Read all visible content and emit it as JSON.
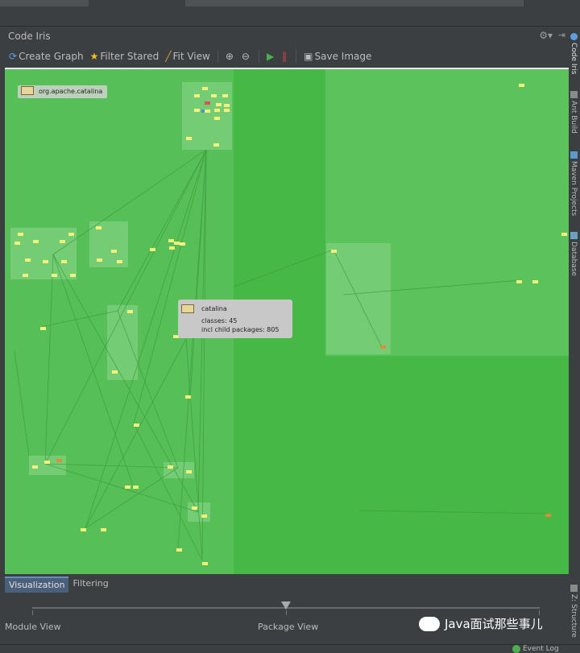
{
  "window": {
    "title": "Code Iris"
  },
  "toolbar": {
    "create_graph": "Create Graph",
    "filter_stared": "Filter Stared",
    "fit_view": "Fit View",
    "save_image": "Save Image"
  },
  "graph": {
    "root_package": "org.apache.catalina",
    "tooltip": {
      "name": "catalina",
      "classes": "classes: 45",
      "child_packages": "incl child packages: 805"
    }
  },
  "bottom_tabs": [
    {
      "label": "Visualization",
      "active": true
    },
    {
      "label": "Filtering",
      "active": false
    }
  ],
  "view_slider": {
    "left_label": "Module View",
    "middle_label": "Package View",
    "position_fraction": 0.5
  },
  "side_tabs": [
    {
      "label": "Code Iris",
      "icon": "code-iris-icon"
    },
    {
      "label": "Ant Build",
      "icon": "ant-icon"
    },
    {
      "label": "Maven Projects",
      "icon": "maven-icon"
    },
    {
      "label": "Database",
      "icon": "database-icon"
    },
    {
      "label": "Z: Structure",
      "icon": "structure-icon"
    }
  ],
  "status_bar": {
    "event_log": "Event Log"
  },
  "watermark": "Java面试那些事儿",
  "colors": {
    "canvas_bg": "#45b845",
    "node_region": "#6cc96c",
    "class_node": "#f5f07a",
    "accent_tab": "#4a5f7a"
  }
}
